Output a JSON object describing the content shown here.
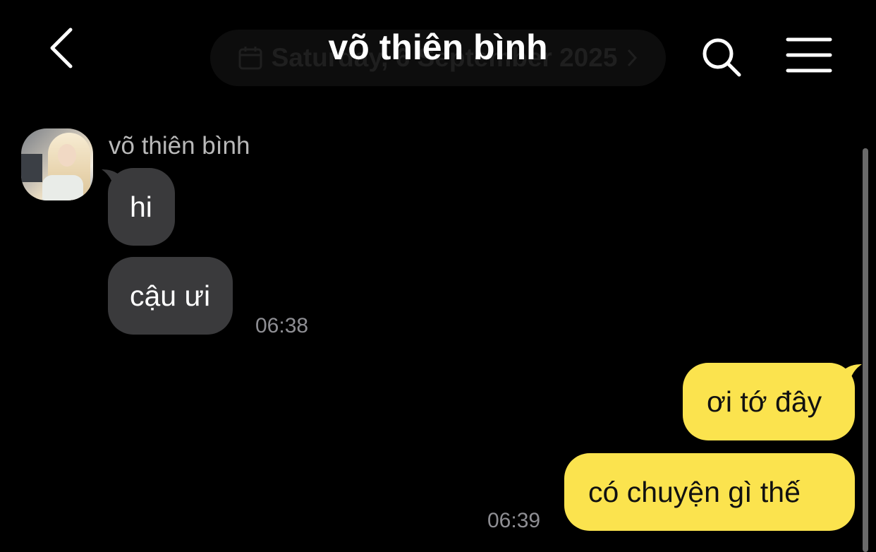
{
  "header": {
    "title": "võ thiên bình",
    "date_pill_label": "Saturday, 6 September 2025"
  },
  "chat": {
    "incoming": {
      "sender_name": "võ thiên bình",
      "messages": [
        {
          "text": "hi"
        },
        {
          "text": "cậu ưi"
        }
      ],
      "time": "06:38"
    },
    "outgoing": {
      "messages": [
        {
          "text": "ơi tớ đây"
        },
        {
          "text": "có chuyện gì thế"
        }
      ],
      "time": "06:39"
    }
  },
  "colors": {
    "background": "#000000",
    "incoming_bubble": "#3a3a3c",
    "outgoing_bubble": "#fbe34e",
    "timestamp": "#8e8e93",
    "sender_name": "#b9b9b9"
  },
  "icons": {
    "back": "chevron-left-icon",
    "date": "calendar-icon",
    "search": "search-icon",
    "menu": "hamburger-menu-icon"
  }
}
